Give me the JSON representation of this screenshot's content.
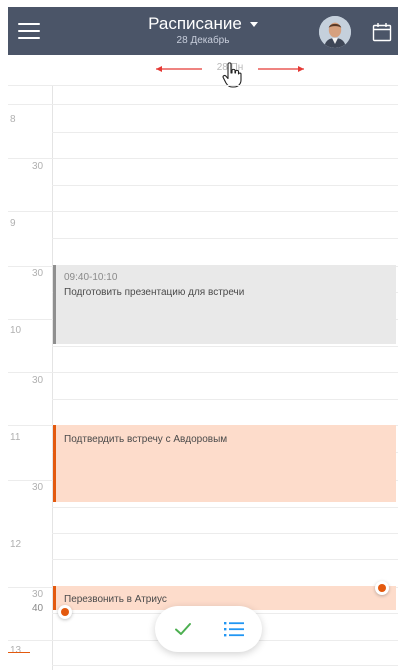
{
  "header": {
    "title": "Расписание",
    "subtitle": "28 Декабрь",
    "bg_color": "#4b5568"
  },
  "swipe_hint": {
    "text": "28 Пн"
  },
  "timeline": {
    "hours": [
      "8",
      "9",
      "10",
      "11",
      "12",
      "13"
    ],
    "half_label": "30",
    "extra_label": "40"
  },
  "events": [
    {
      "time": "09:40-10:10",
      "title": "Подготовить презентацию для встречи",
      "color": "#e9e9e9"
    },
    {
      "time": "",
      "title": "Подтвердить встречу с Авдоровым",
      "color": "#fddccb"
    },
    {
      "time": "",
      "title": "Перезвонить в Атриус",
      "color": "#fddccb"
    }
  ],
  "icons": {
    "menu": "hamburger-icon",
    "calendar": "calendar-icon",
    "check": "check-icon",
    "list": "list-icon",
    "cursor": "hand-pointer-icon"
  },
  "colors": {
    "accent": "#e3590e",
    "check": "#4caf50",
    "list": "#2196f3"
  }
}
